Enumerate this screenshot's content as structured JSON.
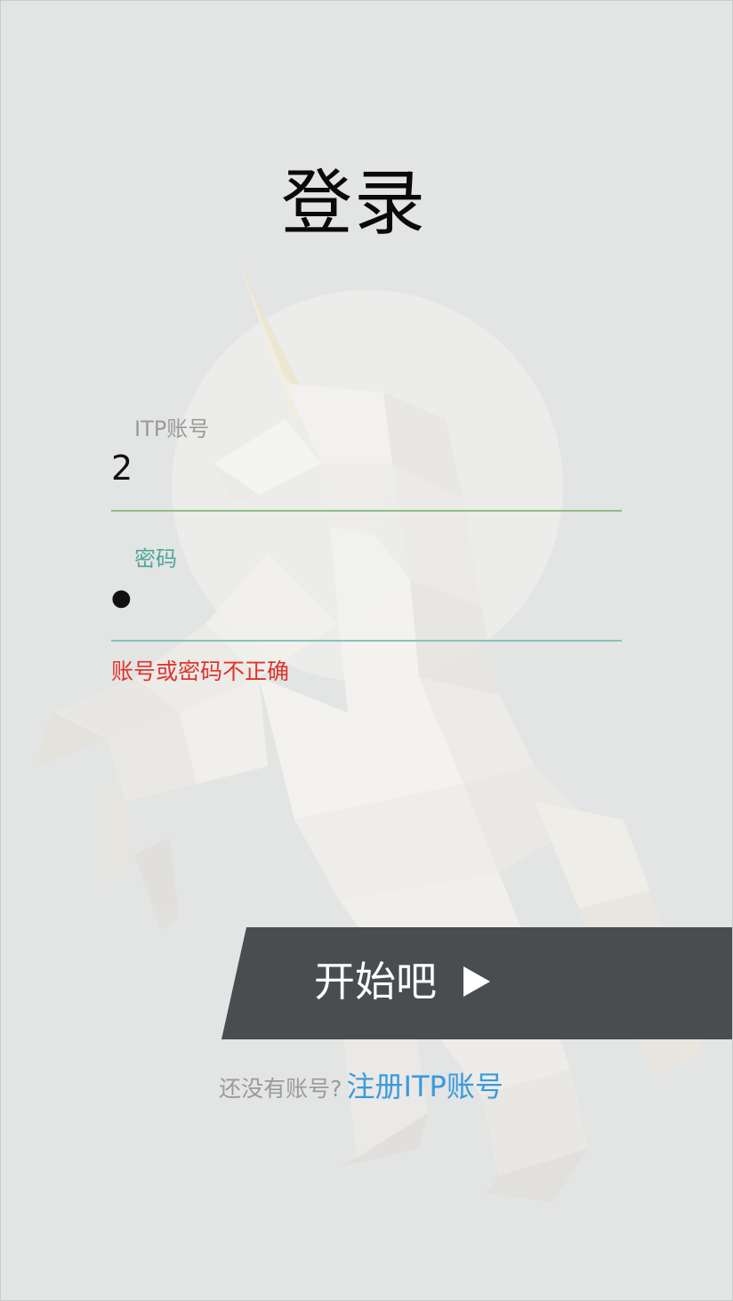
{
  "title": "登录",
  "form": {
    "account": {
      "label": "ITP账号",
      "value": "2"
    },
    "password": {
      "label": "密码",
      "value": "●"
    },
    "error_message": "账号或密码不正确"
  },
  "submit": {
    "label": "开始吧"
  },
  "signup": {
    "prompt": "还没有账号?",
    "link": "注册ITP账号"
  },
  "colors": {
    "background": "#e3e4e4",
    "account_label": "#9a9a9a",
    "focused_label": "#4fa89a",
    "account_underline": "#8fbe86",
    "password_underline": "#86c2ba",
    "error": "#e0352d",
    "button": "#4a4d50",
    "link": "#3a9bdc"
  },
  "icons": {
    "button_arrow": "play-triangle-icon",
    "background_art": "low-poly-unicorn-illustration"
  }
}
